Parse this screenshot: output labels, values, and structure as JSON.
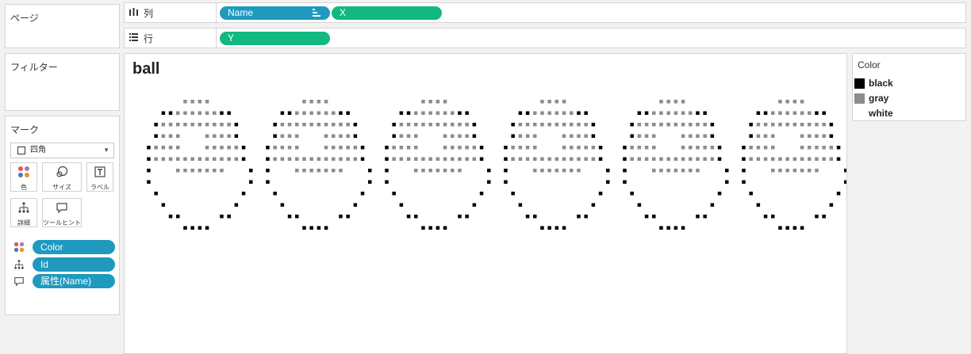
{
  "pages_panel": {
    "title": "ページ"
  },
  "filters_panel": {
    "title": "フィルター"
  },
  "marks_panel": {
    "title": "マーク",
    "mark_type": "四角",
    "buttons": [
      {
        "label": "色",
        "icon": "color-dots-icon"
      },
      {
        "label": "サイズ",
        "icon": "size-icon"
      },
      {
        "label": "ラベル",
        "icon": "label-icon"
      },
      {
        "label": "詳細",
        "icon": "detail-icon"
      },
      {
        "label": "ツールヒント",
        "icon": "tooltip-icon"
      }
    ],
    "fields": [
      {
        "name": "Color",
        "icon": "color-dots-icon"
      },
      {
        "name": "Id",
        "icon": "detail-icon"
      },
      {
        "name": "属性(Name)",
        "icon": "tooltip-icon"
      }
    ]
  },
  "columns_shelf": {
    "label": "列",
    "pills": [
      "Name",
      "X"
    ]
  },
  "rows_shelf": {
    "label": "行",
    "pills": [
      "Y"
    ]
  },
  "view": {
    "title": "ball",
    "panel_count": 6
  },
  "legend": {
    "title": "Color",
    "items": [
      {
        "label": "black",
        "color": "#000000"
      },
      {
        "label": "gray",
        "color": "#8c8c8c"
      },
      {
        "label": "white",
        "color": "#ffffff"
      }
    ]
  },
  "colors": {
    "pill_blue": "#1f99be",
    "pill_green": "#11b981"
  }
}
